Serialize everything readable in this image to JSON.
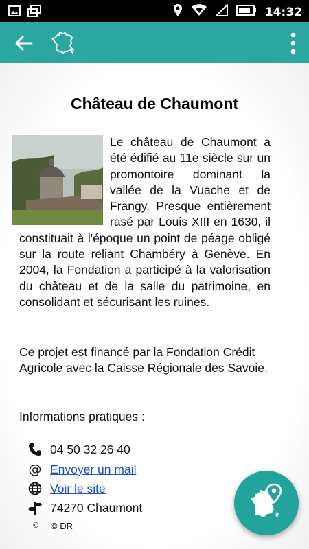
{
  "status_bar": {
    "time": "14:32",
    "icons": [
      "image-icon",
      "gallery-icon",
      "location-icon",
      "wifi-icon",
      "signal-icon",
      "battery-icon"
    ]
  },
  "app_bar": {
    "icons": [
      "back-arrow-icon",
      "france-map-icon",
      "overflow-menu-icon"
    ],
    "color": "#2aa7a0"
  },
  "article": {
    "title": "Château de Chaumont",
    "paragraph1": "Le château de Chaumont a été édifié au 11e siècle sur un promontoire dominant la vallée de la Vuache et de Frangy. Presque entièrement rasé par Louis XIII en 1630, il constituait à l'époque un point de péage obligé sur la route reliant Chambéry à Genève. En 2004, la Fondation a participé à la valorisation du château et de la salle du patrimoine, en consolidant et sécurisant les ruines.",
    "paragraph2": "Ce projet est financé par la Fondation Crédit Agricole avec la Caisse Régionale des Savoie.",
    "info_heading": "Informations pratiques :"
  },
  "info": {
    "phone": "04 50 32 26 40",
    "email_link": "Envoyer un mail",
    "site_link": "Voir le site",
    "address": "74270 Chaumont",
    "credit": "© DR"
  },
  "fab": {
    "icon": "france-map-pin-icon",
    "color": "#22a39c"
  }
}
